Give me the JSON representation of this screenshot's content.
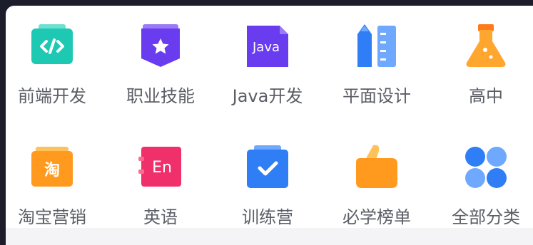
{
  "categories": [
    {
      "label": "前端开发",
      "icon": "code-icon",
      "color": "#1ec9b3"
    },
    {
      "label": "职业技能",
      "icon": "badge-star-icon",
      "color": "#6a3cf0"
    },
    {
      "label": "Java开发",
      "icon": "java-file-icon",
      "color": "#6a3cf0",
      "icon_text": "Java"
    },
    {
      "label": "平面设计",
      "icon": "pencil-ruler-icon",
      "color": "#2f7ef6"
    },
    {
      "label": "高中",
      "icon": "flask-icon",
      "color": "#ff9a1f"
    },
    {
      "label": "淘宝营销",
      "icon": "taobao-folder-icon",
      "color": "#ff9a1f",
      "icon_text": "淘"
    },
    {
      "label": "英语",
      "icon": "english-book-icon",
      "color": "#f0306a",
      "icon_text": "En"
    },
    {
      "label": "训练营",
      "icon": "checklist-icon",
      "color": "#2f7ef6"
    },
    {
      "label": "必学榜单",
      "icon": "thumbs-up-icon",
      "color": "#ff9a1f"
    },
    {
      "label": "全部分类",
      "icon": "four-dots-icon",
      "color": "#2f7ef6"
    }
  ]
}
